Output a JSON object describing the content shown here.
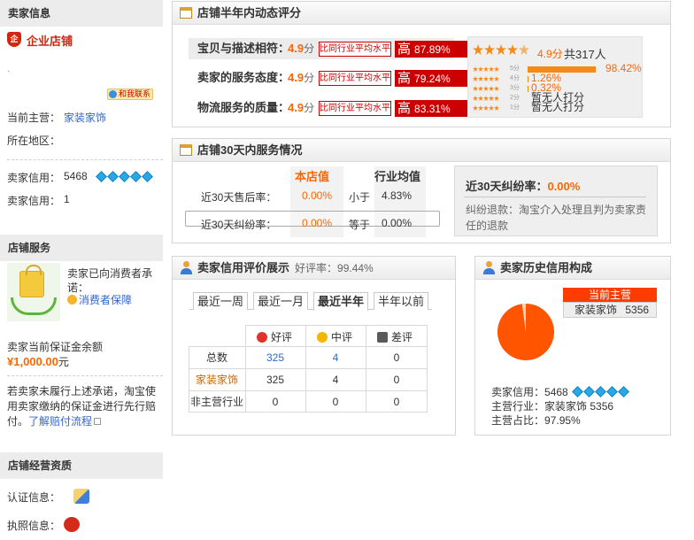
{
  "sidebar": {
    "seller_info": {
      "title": "卖家信息",
      "shop_type": "企业店铺",
      "shield_text": "企",
      "contact_badge": "和我联系",
      "main_business_label": "当前主营：",
      "main_business_value": "家装家饰",
      "location_label": "所在地区：",
      "credit_label": "卖家信用：",
      "credit_value": "5468",
      "rate_label": "卖家信用：",
      "rate_value": "1"
    },
    "shop_service": {
      "title": "店铺服务",
      "promise_text": "卖家已向消费者承诺：",
      "guarantee_link": "消费者保障",
      "deposit_label": "卖家当前保证金余额",
      "deposit_amount": "¥1,000.00",
      "deposit_unit": "元",
      "notice_text": "若卖家未履行上述承诺，淘宝使用卖家缴纳的保证金进行先行赔付。",
      "notice_link": "了解赔付流程"
    },
    "qualification": {
      "title": "店铺经营资质",
      "cert_label": "认证信息：",
      "license_label": "执照信息："
    }
  },
  "dsr_panel": {
    "title": "店铺半年内动态评分",
    "rows": [
      {
        "label": "宝贝与描述相符：",
        "score": "4.9",
        "unit": "分",
        "compare": "比同行业平均水平",
        "level": "高",
        "percent": "87.89%"
      },
      {
        "label": "卖家的服务态度：",
        "score": "4.9",
        "unit": "分",
        "compare": "比同行业平均水平",
        "level": "高",
        "percent": "79.24%"
      },
      {
        "label": "物流服务的质量：",
        "score": "4.9",
        "unit": "分",
        "compare": "比同行业平均水平",
        "level": "高",
        "percent": "83.31%"
      }
    ],
    "summary_score": "4.9分",
    "summary_count": "共317人",
    "summary_star_fill": 0.9,
    "distribution": [
      {
        "stars": "5分",
        "percent": "98.42%",
        "fraction": 0.9842
      },
      {
        "stars": "4分",
        "percent": "1.26%",
        "fraction": 0.0126
      },
      {
        "stars": "3分",
        "percent": "0.32%",
        "fraction": 0.0032
      },
      {
        "stars": "2分",
        "percent": "暂无人打分",
        "fraction": 0
      },
      {
        "stars": "1分",
        "percent": "暂无人打分",
        "fraction": 0
      }
    ]
  },
  "service_panel": {
    "title": "店铺30天内服务情况",
    "col_shop": "本店值",
    "col_industry": "行业均值",
    "rows": [
      {
        "label": "近30天售后率：",
        "shop_value": "0.00%",
        "compare": "小于",
        "industry_value": "4.83%"
      },
      {
        "label": "近30天纠纷率：",
        "shop_value": "0.00%",
        "compare": "等于",
        "industry_value": "0.00%"
      }
    ],
    "dispute_title": "近30天纠纷率：",
    "dispute_value": "0.00%",
    "dispute_desc": "纠纷退款：淘宝介入处理且判为卖家责任的退款"
  },
  "credit_panel": {
    "title": "卖家信用评价展示",
    "good_rate_label": "好评率：",
    "good_rate_value": "99.44%",
    "tabs": [
      "最近一周",
      "最近一月",
      "最近半年",
      "半年以前"
    ],
    "active_tab": 2,
    "col_good": "好评",
    "col_mid": "中评",
    "col_bad": "差评",
    "rows": [
      {
        "label": "总数",
        "good": "325",
        "mid": "4",
        "bad": "0"
      },
      {
        "label": "家装家饰",
        "good": "325",
        "mid": "4",
        "bad": "0"
      },
      {
        "label": "非主营行业",
        "good": "0",
        "mid": "0",
        "bad": "0"
      }
    ]
  },
  "history_panel": {
    "title": "卖家历史信用构成",
    "legend_badge": "当前主营",
    "legend_category": "家装家饰",
    "legend_value": "5356",
    "pie_fraction": 0.9795,
    "credit_label": "卖家信用：",
    "credit_value": "5468",
    "main_label": "主营行业：",
    "main_value": "家装家饰 5356",
    "ratio_label": "主营占比：",
    "ratio_value": "97.95%"
  },
  "colors": {
    "accent": "#ff6600",
    "high": "#cc0000",
    "link": "#3366cc",
    "pie": "#ff5500"
  }
}
